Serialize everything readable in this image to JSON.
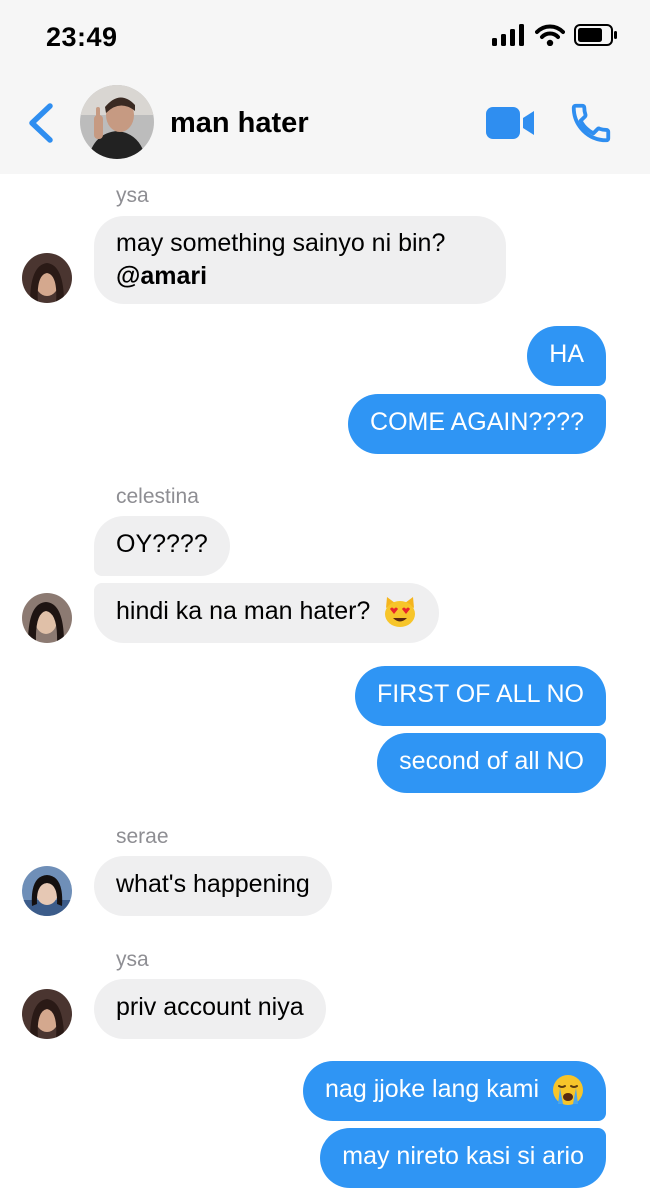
{
  "status_bar": {
    "time": "23:49"
  },
  "header": {
    "title": "man hater"
  },
  "messages": {
    "m1_sender": "ysa",
    "m1_line1": "may something sainyo ni bin?",
    "m1_mention": "@amari",
    "m2": "HA",
    "m3": "COME AGAIN????",
    "m4_sender": "celestina",
    "m4": "OY????",
    "m5": "hindi ka na man hater?",
    "m6": "FIRST OF ALL NO",
    "m7": "second of all NO",
    "m8_sender": "serae",
    "m8": "what's happening",
    "m9_sender": "ysa",
    "m9": "priv account niya",
    "m10": "nag jjoke lang kami",
    "m11": "may nireto kasi si ario"
  },
  "colors": {
    "outgoing": "#2f95f4",
    "incoming": "#efeff0",
    "accent": "#2f8ef0"
  },
  "icons": [
    "back-chevron-icon",
    "video-call-icon",
    "phone-icon",
    "signal-icon",
    "wifi-icon",
    "battery-icon",
    "heart-eyes-cat-emoji",
    "crying-face-emoji"
  ]
}
